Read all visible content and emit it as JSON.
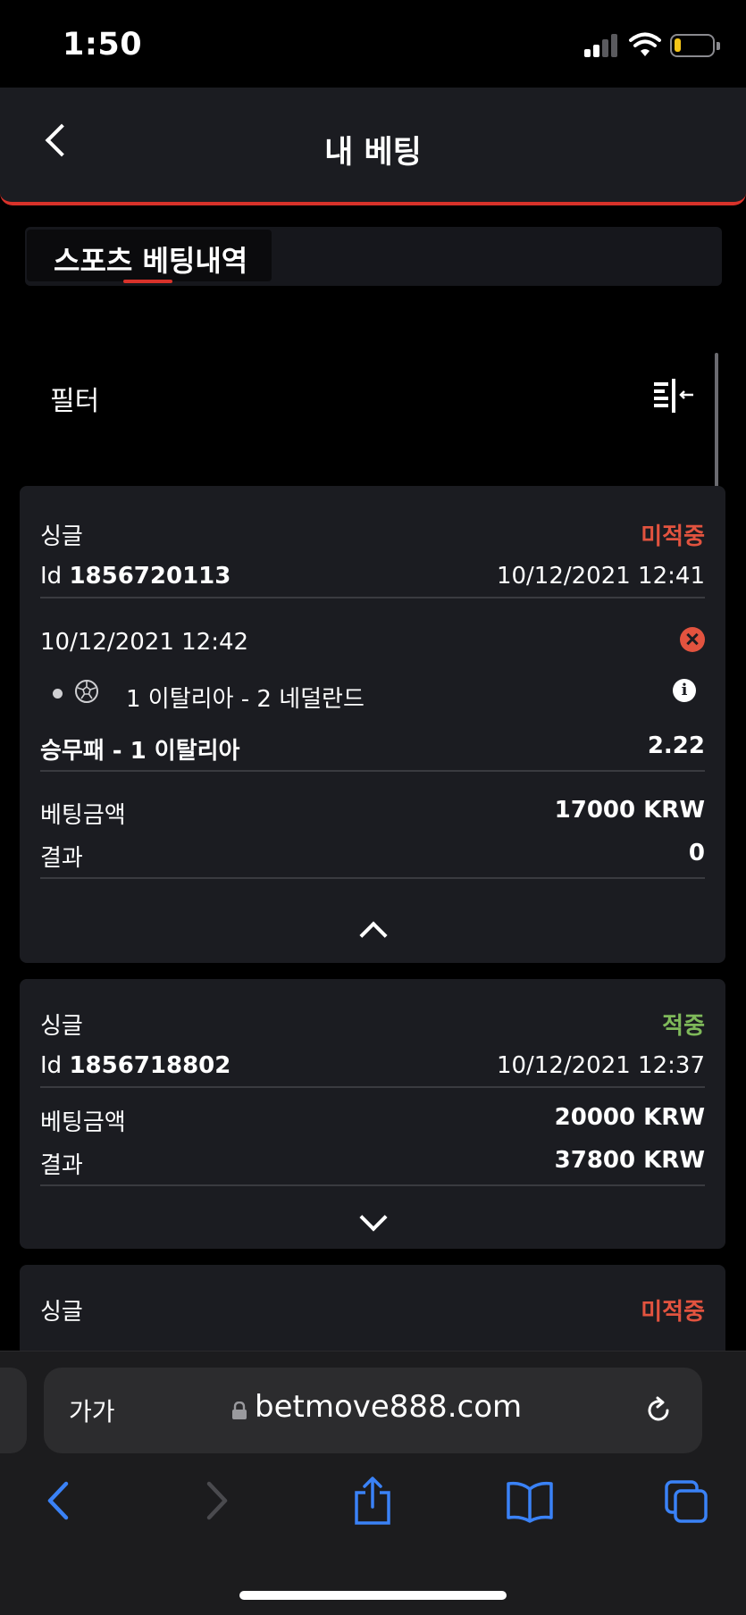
{
  "status_bar": {
    "time": "1:50"
  },
  "header": {
    "title": "내 베팅"
  },
  "tabs": [
    {
      "label": "스포츠 베팅내역"
    }
  ],
  "filter": {
    "label": "필터"
  },
  "bets": [
    {
      "type": "싱글",
      "status": "미적중",
      "id_prefix": "Id",
      "id": "1856720113",
      "datetime": "10/12/2021 12:41",
      "selection": {
        "datetime": "10/12/2021 12:42",
        "match": "1 이탈리아 - 2 네덜란드",
        "market": "승무패 - 1 이탈리아",
        "odds": "2.22"
      },
      "stake_label": "베팅금액",
      "stake": "17000 KRW",
      "result_label": "결과",
      "result": "0"
    },
    {
      "type": "싱글",
      "status": "적중",
      "id_prefix": "Id",
      "id": "1856718802",
      "datetime": "10/12/2021 12:37",
      "stake_label": "베팅금액",
      "stake": "20000 KRW",
      "result_label": "결과",
      "result": "37800 KRW"
    },
    {
      "type": "싱글",
      "status": "미적중"
    }
  ],
  "browser": {
    "text_size_label": "가가",
    "url": "betmove888.com"
  },
  "colors": {
    "accent": "#d8322a",
    "lost": "#e2533f",
    "won": "#7fb95a",
    "card": "#1b1c21",
    "ios_blue": "#3a82f7"
  }
}
